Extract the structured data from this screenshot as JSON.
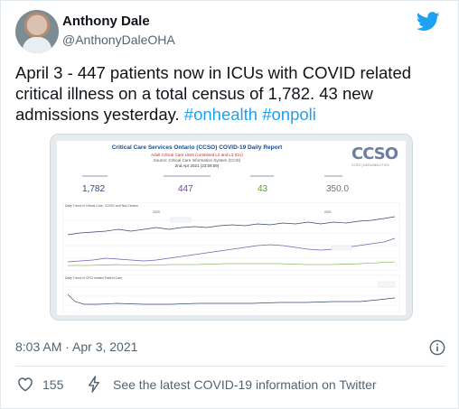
{
  "author": {
    "name": "Anthony Dale",
    "handle": "@AnthonyDaleOHA"
  },
  "tweet": {
    "text": "April 3 - 447 patients now in ICUs with COVID related critical illness on a total census of 1,782. 43 new admissions yesterday. ",
    "hashtags": [
      "#onhealth",
      "#onpoli"
    ]
  },
  "report": {
    "title": "Critical Care Services Ontario (CCSO) COVID-19 Daily Report",
    "subtitle": "Adult Critical Care Units (combined L2 and L3 ICU)",
    "source": "Source: Critical Care Information System (CCIS)",
    "date": "2nd Apr 2021 (23:59:59)",
    "logo": "CCSO",
    "logo_sub": "CCSO | DATA ANALYTICS",
    "stats": [
      {
        "value": "1,782",
        "color": "#1a4b8c"
      },
      {
        "value": "447",
        "color": "#6a4a9c"
      },
      {
        "value": "43",
        "color": "#5aa02c"
      },
      {
        "value": "350.0",
        "color": "#6b7280"
      }
    ],
    "chart1_caption": "Daily Trend of Critical Care, COVID and Net Census",
    "chart2_caption": "Daily Trend of CRCI related Patient Care",
    "year_labels": [
      "2020",
      "2021"
    ]
  },
  "meta": {
    "timestamp": "8:03 AM · Apr 3, 2021"
  },
  "actions": {
    "like_count": "155",
    "covid_info": "See the latest COVID-19 information on Twitter"
  },
  "colors": {
    "accent": "#1da1f2",
    "text": "#0f1419",
    "muted": "#536471"
  }
}
